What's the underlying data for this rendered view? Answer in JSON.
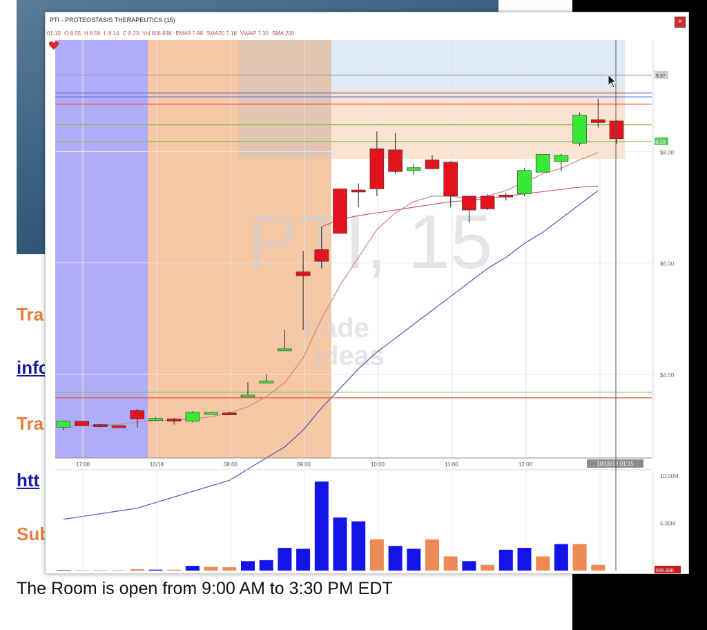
{
  "page": {
    "left_texts": [
      {
        "id": "tra1",
        "text": "Tra",
        "style": "orange",
        "top": 440
      },
      {
        "id": "info",
        "text": "info",
        "style": "link",
        "top": 517
      },
      {
        "id": "tra2",
        "text": "Tra",
        "style": "orange",
        "top": 598
      },
      {
        "id": "http",
        "text": "htt",
        "style": "link",
        "top": 680
      },
      {
        "id": "sub",
        "text": "Sub",
        "style": "orange",
        "top": 758
      }
    ],
    "room_hours": "The Room is open from 9:00 AM to 3:30 PM EDT"
  },
  "window": {
    "title": "PTI - PROTEOSTASIS THERAPEUTICS (15)",
    "close_label": "×",
    "indicators": [
      "01:15",
      "O 8.55",
      "H 8.56",
      "L 8.14",
      "C 8.23",
      "Vol 606.93K",
      "EMA8 7.98",
      "SMA20 7.18",
      "VWAP 7.30",
      "SMA 200"
    ],
    "watermark_symbol": "PTI, 15",
    "watermark_logo": [
      "trade",
      "ideas"
    ],
    "time_badge": "10/18/18 01:15",
    "price_badges": [
      "9.37",
      "8.23"
    ]
  },
  "colors": {
    "up": "#37e837",
    "down": "#e3131d",
    "vol_blue": "#1414e6",
    "vol_orange": "#ee8a55",
    "premarket_purple": "#b1acf8",
    "session_orange": "#f7c8a6",
    "gray_zone": "#d8c5b8",
    "top_zone_blue": "#deeaf6",
    "top_zone_orange": "#fbe3d2"
  },
  "chart_data": {
    "type": "candlestick",
    "x_ticks": [
      "17:00",
      "10/18",
      "08:00",
      "09:00",
      "10:00",
      "11:00",
      "12:00"
    ],
    "y_ticks": [
      "$8.00",
      "$6.00",
      "$4.00"
    ],
    "volume_ticks": [
      "10.00M",
      "5.00M",
      "606.93K"
    ],
    "candles": [
      {
        "o": 3.05,
        "h": 3.08,
        "l": 3.0,
        "c": 3.16
      },
      {
        "o": 3.16,
        "h": 3.17,
        "l": 3.1,
        "c": 3.08
      },
      {
        "o": 3.1,
        "h": 3.11,
        "l": 3.07,
        "c": 3.08
      },
      {
        "o": 3.08,
        "h": 3.09,
        "l": 3.05,
        "c": 3.06
      },
      {
        "o": 3.35,
        "h": 3.38,
        "l": 3.05,
        "c": 3.2
      },
      {
        "o": 3.2,
        "h": 3.23,
        "l": 3.16,
        "c": 3.21
      },
      {
        "o": 3.2,
        "h": 3.22,
        "l": 3.1,
        "c": 3.16
      },
      {
        "o": 3.16,
        "h": 3.34,
        "l": 3.14,
        "c": 3.32
      },
      {
        "o": 3.31,
        "h": 3.33,
        "l": 3.28,
        "c": 3.32
      },
      {
        "o": 3.31,
        "h": 3.33,
        "l": 3.29,
        "c": 3.3
      },
      {
        "o": 3.62,
        "h": 3.86,
        "l": 3.6,
        "c": 3.63
      },
      {
        "o": 3.87,
        "h": 4.0,
        "l": 3.84,
        "c": 3.88
      },
      {
        "o": 4.44,
        "h": 4.8,
        "l": 4.42,
        "c": 4.46
      },
      {
        "o": 5.84,
        "h": 6.22,
        "l": 4.8,
        "c": 5.77
      },
      {
        "o": 6.24,
        "h": 6.65,
        "l": 5.9,
        "c": 6.03
      },
      {
        "o": 7.33,
        "h": 7.28,
        "l": 6.9,
        "c": 6.53
      },
      {
        "o": 7.31,
        "h": 7.43,
        "l": 7.0,
        "c": 7.3
      },
      {
        "o": 8.05,
        "h": 8.36,
        "l": 7.2,
        "c": 7.33
      },
      {
        "o": 8.03,
        "h": 8.33,
        "l": 7.6,
        "c": 7.64
      },
      {
        "o": 7.66,
        "h": 7.78,
        "l": 7.58,
        "c": 7.71
      },
      {
        "o": 7.85,
        "h": 7.93,
        "l": 7.75,
        "c": 7.69
      },
      {
        "o": 7.81,
        "h": 7.83,
        "l": 7.0,
        "c": 7.2
      },
      {
        "o": 7.2,
        "h": 7.1,
        "l": 6.72,
        "c": 6.95
      },
      {
        "o": 7.2,
        "h": 7.23,
        "l": 6.95,
        "c": 6.97
      },
      {
        "o": 7.22,
        "h": 7.26,
        "l": 7.12,
        "c": 7.19
      },
      {
        "o": 7.24,
        "h": 7.7,
        "l": 7.2,
        "c": 7.66
      },
      {
        "o": 7.63,
        "h": 7.93,
        "l": 7.63,
        "c": 7.95
      },
      {
        "o": 7.82,
        "h": 7.96,
        "l": 7.64,
        "c": 7.93
      },
      {
        "o": 8.15,
        "h": 8.7,
        "l": 8.1,
        "c": 8.65
      },
      {
        "o": 8.57,
        "h": 8.95,
        "l": 8.43,
        "c": 8.52
      },
      {
        "o": 8.55,
        "h": 8.56,
        "l": 8.14,
        "c": 8.23
      }
    ],
    "volume": [
      0.05,
      0.05,
      0.05,
      0.05,
      0.15,
      0.1,
      0.1,
      0.5,
      0.4,
      0.35,
      1.0,
      1.1,
      2.4,
      2.3,
      9.4,
      5.6,
      5.2,
      3.3,
      2.6,
      2.3,
      3.3,
      1.5,
      1.0,
      0.6,
      2.2,
      2.4,
      1.5,
      2.8,
      2.8,
      0.6
    ],
    "volume_up": [
      1,
      0,
      0,
      0,
      0,
      1,
      0,
      1,
      0,
      0,
      1,
      1,
      1,
      1,
      1,
      1,
      1,
      0,
      1,
      1,
      0,
      0,
      1,
      0,
      1,
      1,
      0,
      1,
      0,
      0
    ],
    "lines": {
      "sma200": [
        1.4,
        1.45,
        1.5,
        1.55,
        1.6,
        1.7,
        1.8,
        1.9,
        2.0,
        2.1,
        2.3,
        2.5,
        2.7,
        3.0,
        3.4,
        3.75,
        4.1,
        4.4,
        4.65,
        4.9,
        5.15,
        5.4,
        5.65,
        5.9,
        6.1,
        6.35,
        6.55,
        6.8,
        7.05,
        7.3
      ],
      "vwap": [
        0.88,
        0.88,
        0.88,
        0.88,
        0.88,
        0.88,
        0.88,
        0.88,
        0.88,
        0.88,
        0.88,
        0.88,
        0.88,
        0.9,
        6.65,
        6.78,
        6.85,
        6.9,
        6.95,
        7.0,
        7.05,
        7.1,
        7.12,
        7.16,
        7.2,
        7.24,
        7.28,
        7.32,
        7.36,
        7.38
      ],
      "ema8": [
        3.07,
        3.08,
        3.09,
        3.1,
        3.14,
        3.17,
        3.18,
        3.2,
        3.24,
        3.31,
        3.42,
        3.6,
        3.85,
        4.3,
        5.0,
        5.6,
        6.1,
        6.6,
        6.9,
        7.1,
        7.2,
        7.2,
        7.15,
        7.2,
        7.3,
        7.45,
        7.6,
        7.7,
        7.85,
        7.98
      ]
    },
    "levels": [
      {
        "y": 9.37,
        "color": "#9aa0a6"
      },
      {
        "y": 9.05,
        "color": "#4f6fdc"
      },
      {
        "y": 8.98,
        "color": "#4f6fdc"
      },
      {
        "y": 8.85,
        "color": "#e8574a"
      },
      {
        "y": 8.48,
        "color": "#7ec04a"
      },
      {
        "y": 8.18,
        "color": "#7ec04a"
      },
      {
        "y": 3.68,
        "color": "#7ec04a"
      },
      {
        "y": 3.58,
        "color": "#e8574a"
      }
    ],
    "ylim": [
      2.5,
      10.0
    ]
  }
}
